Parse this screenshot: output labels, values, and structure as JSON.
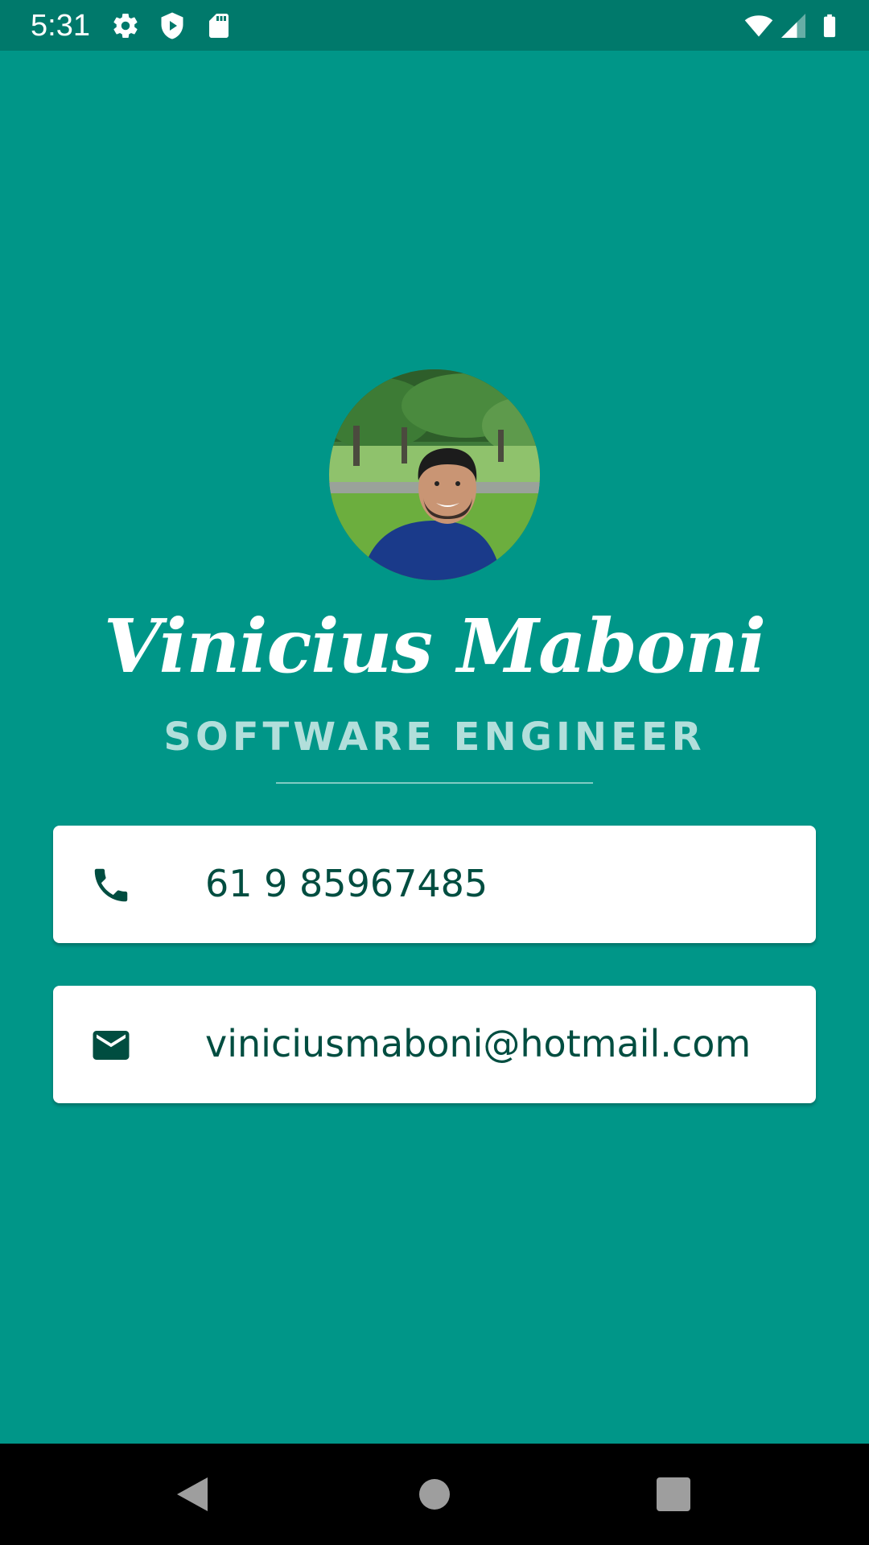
{
  "status_bar": {
    "time": "5:31",
    "icons": [
      "settings-icon",
      "shield-play-icon",
      "sd-card-icon",
      "wifi-icon",
      "cell-signal-icon",
      "battery-icon"
    ]
  },
  "profile": {
    "name": "Vinicius Maboni",
    "title": "SOFTWARE ENGINEER",
    "avatar": "profile-photo"
  },
  "contacts": [
    {
      "icon": "phone-icon",
      "value": "61 9 85967485"
    },
    {
      "icon": "email-icon",
      "value": "viniciusmaboni@hotmail.com"
    }
  ],
  "nav": [
    "back-icon",
    "home-icon",
    "recents-icon"
  ],
  "colors": {
    "background": "#009688",
    "status_bar": "#00796b",
    "title_text": "#b2dfdb",
    "card_text": "#004d40"
  }
}
